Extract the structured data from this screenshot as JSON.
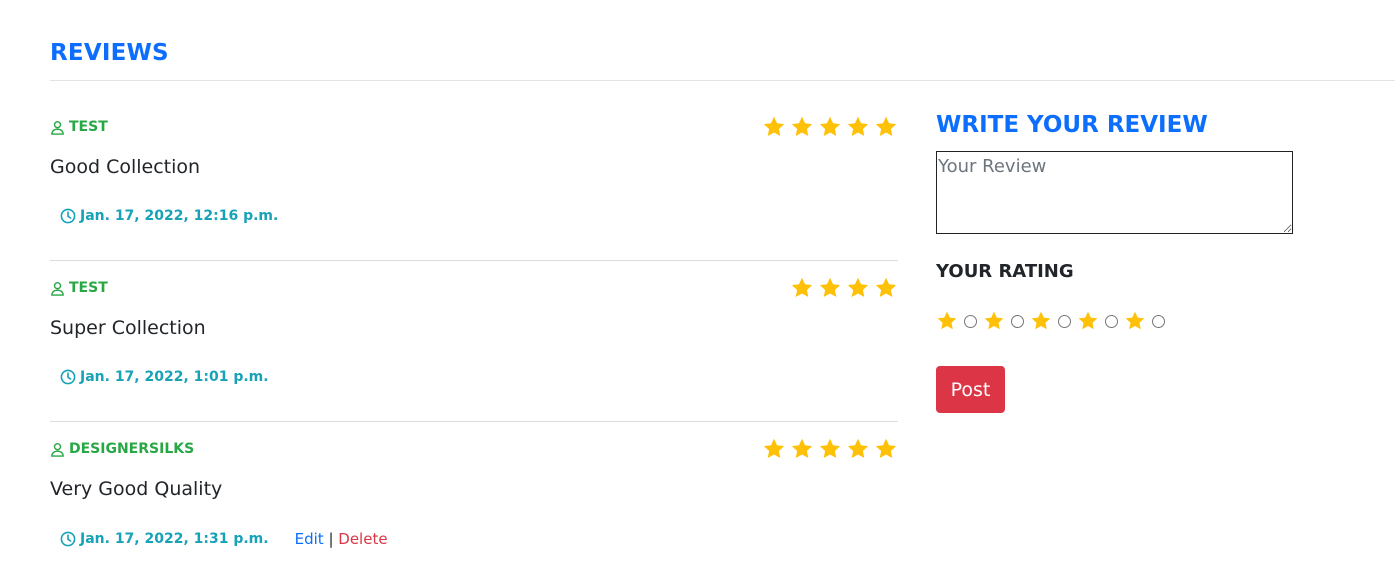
{
  "page": {
    "section_title": "REVIEWS"
  },
  "reviews": [
    {
      "user": "TEST",
      "rating": 5,
      "text": "Good Collection",
      "date": "Jan. 17, 2022, 12:16 p.m."
    },
    {
      "user": "TEST",
      "rating": 4,
      "text": "Super Collection",
      "date": "Jan. 17, 2022, 1:01 p.m."
    },
    {
      "user": "DESIGNERSILKS",
      "rating": 5,
      "text": "Very Good Quality",
      "date": "Jan. 17, 2022, 1:31 p.m.",
      "edit_label": "Edit",
      "separator": "|",
      "delete_label": "Delete"
    }
  ],
  "write_review": {
    "title": "WRITE YOUR REVIEW",
    "placeholder": "Your Review",
    "rating_label": "YOUR RATING",
    "rating_options": 5,
    "post_label": "Post"
  },
  "colors": {
    "accent": "#0d6efd",
    "user": "#28a745",
    "date": "#17a2b8",
    "star": "#ffc107",
    "danger": "#dc3545"
  },
  "icons": {
    "user": "user-icon",
    "date": "clock-icon",
    "rating": "star-icon"
  }
}
